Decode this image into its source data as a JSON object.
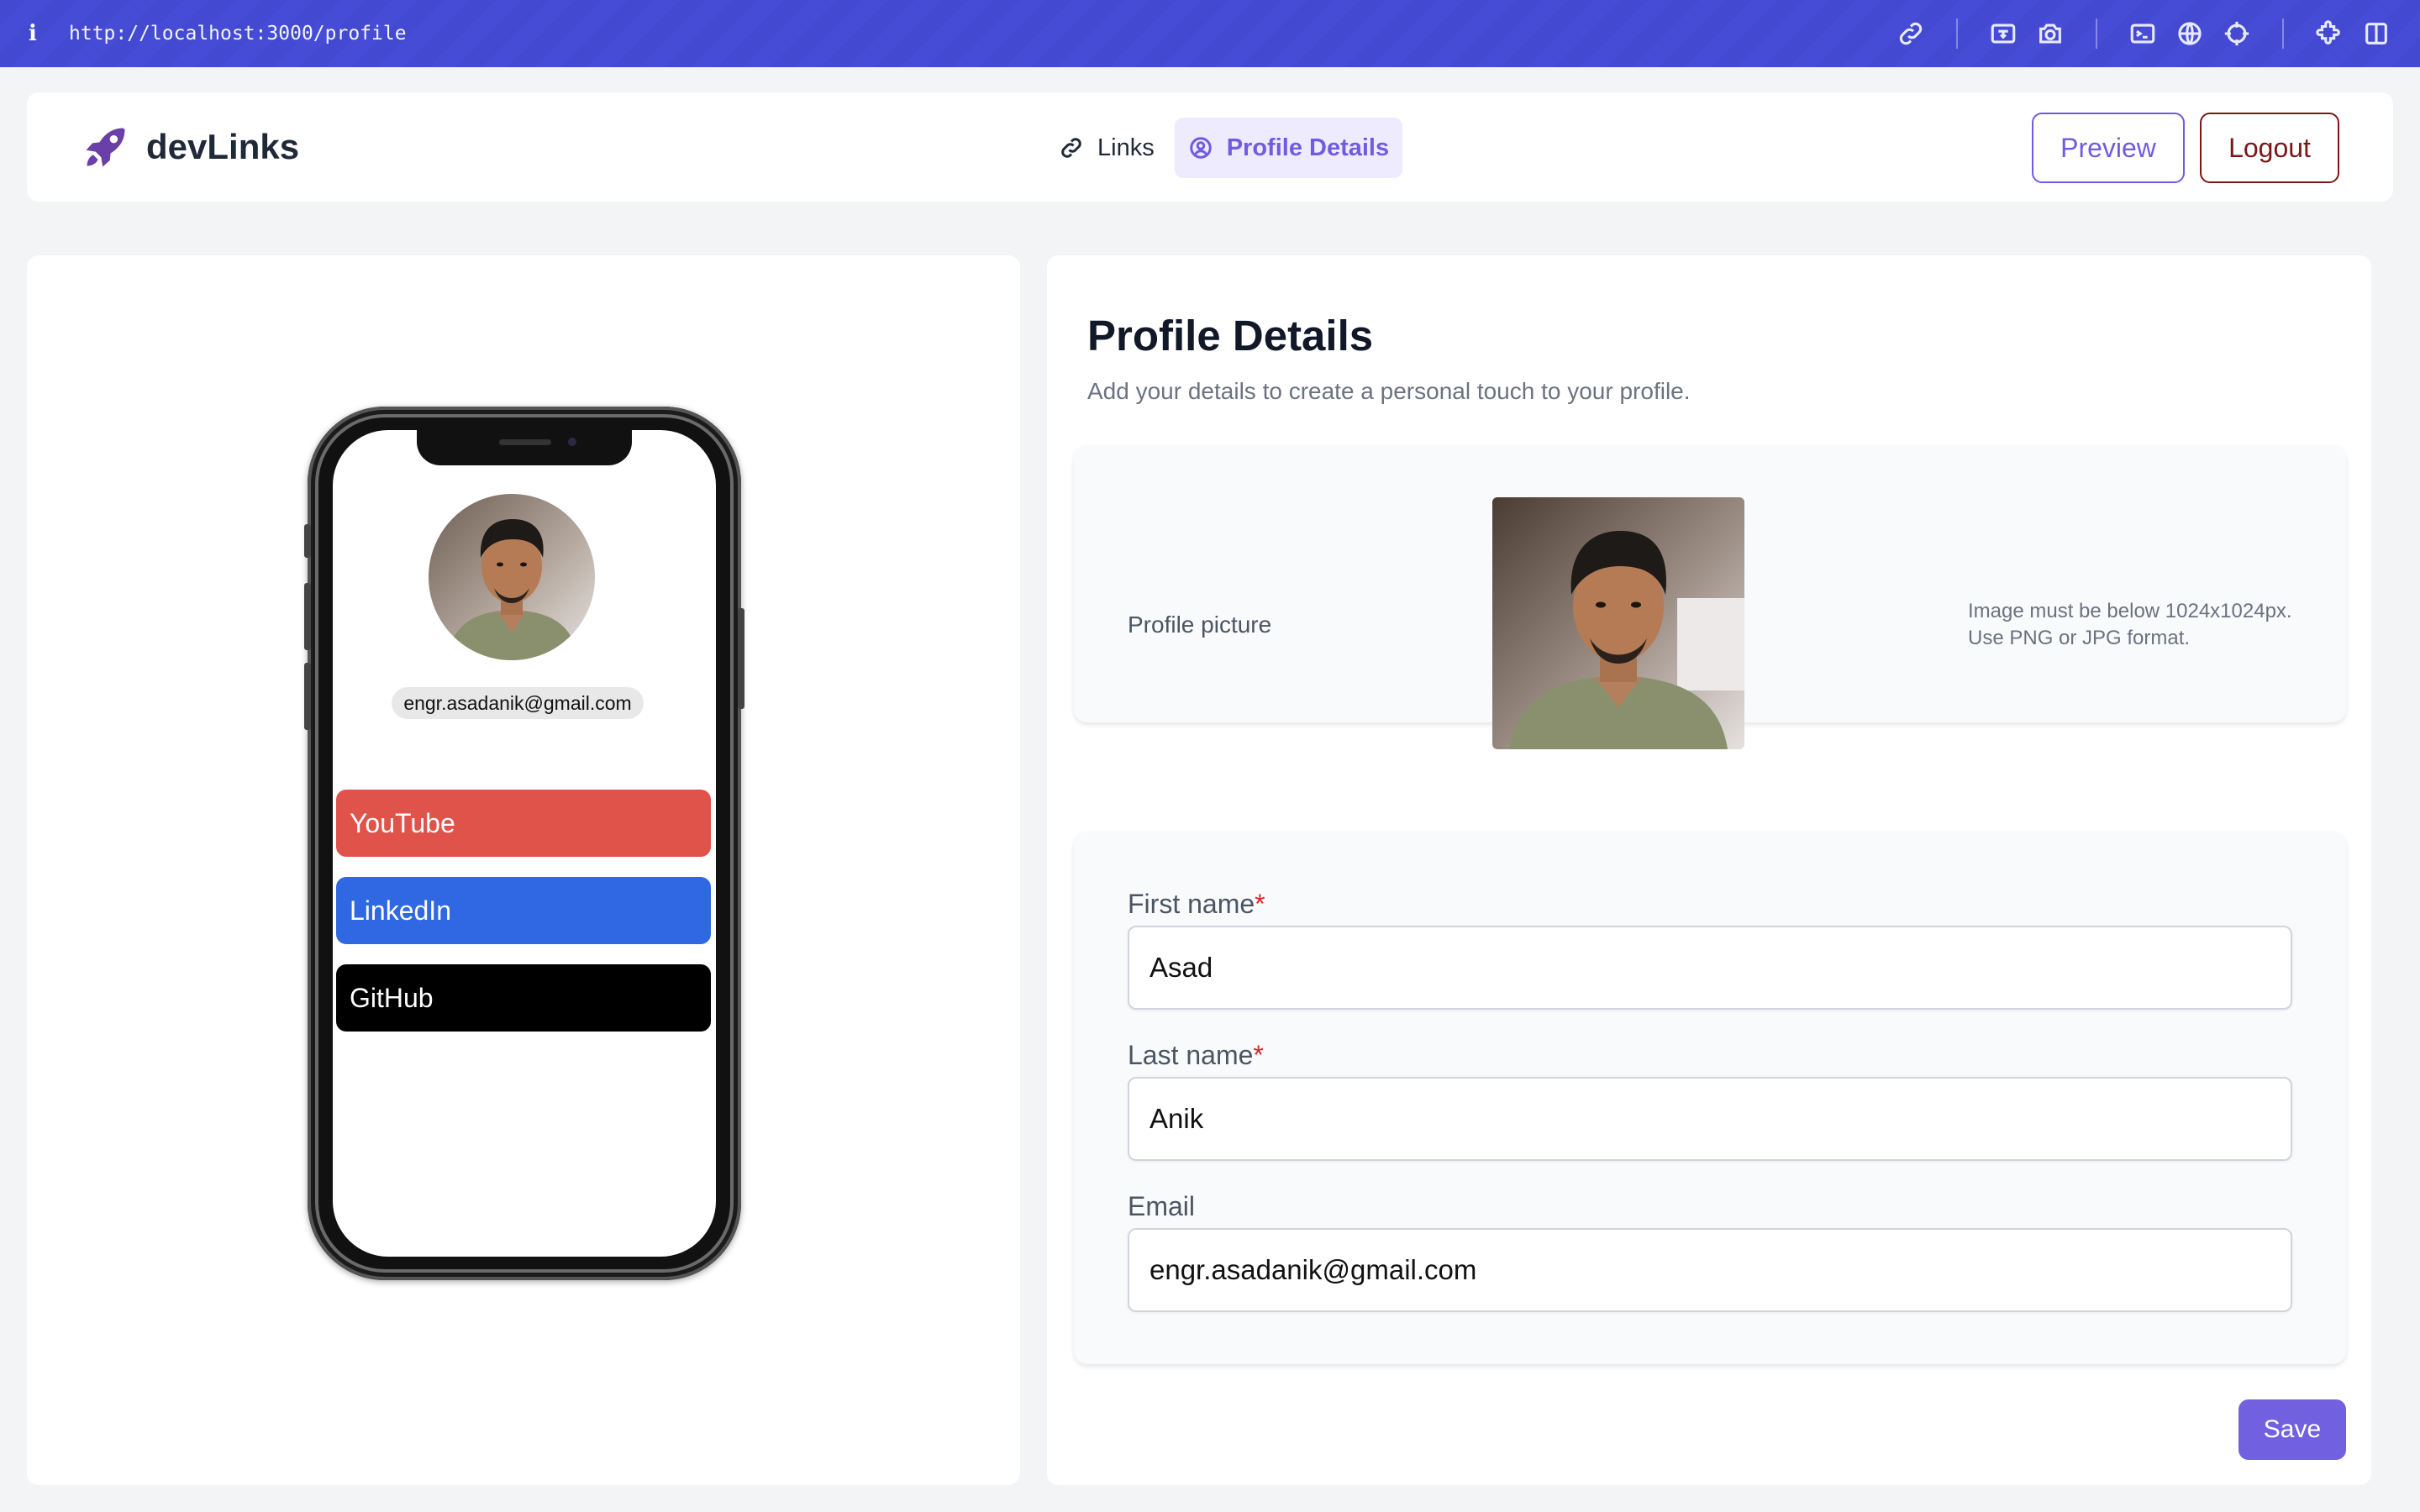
{
  "browser": {
    "info_icon": "i",
    "url": "http://localhost:3000/profile",
    "tools": [
      "link-icon",
      "screenshot-area-icon",
      "camera-icon",
      "terminal-icon",
      "globe-icon",
      "crosshair-icon",
      "extensions-icon",
      "split-view-icon"
    ]
  },
  "header": {
    "brand": "devLinks",
    "nav": [
      {
        "label": "Links",
        "icon": "link-icon",
        "active": false
      },
      {
        "label": "Profile Details",
        "icon": "user-circle-icon",
        "active": true
      }
    ],
    "preview_label": "Preview",
    "logout_label": "Logout"
  },
  "phone": {
    "email": "engr.asadanik@gmail.com",
    "links": [
      {
        "label": "YouTube",
        "color": "#e0534a"
      },
      {
        "label": "LinkedIn",
        "color": "#2f68e2"
      },
      {
        "label": "GitHub",
        "color": "#000000"
      }
    ]
  },
  "profile": {
    "title": "Profile Details",
    "subtitle": "Add your details to create a personal touch to your profile.",
    "picture_label": "Profile picture",
    "picture_note_line1": "Image must be below 1024x1024px.",
    "picture_note_line2": "Use PNG or JPG format.",
    "fields": [
      {
        "label": "First name",
        "required": "*",
        "value": "Asad"
      },
      {
        "label": "Last name",
        "required": "*",
        "value": "Anik"
      },
      {
        "label": "Email",
        "required": "",
        "value": "engr.asadanik@gmail.com"
      }
    ],
    "save_label": "Save"
  },
  "colors": {
    "accent": "#6f5ce0",
    "browser_bar": "#4349d1",
    "logout": "#7a1717"
  }
}
